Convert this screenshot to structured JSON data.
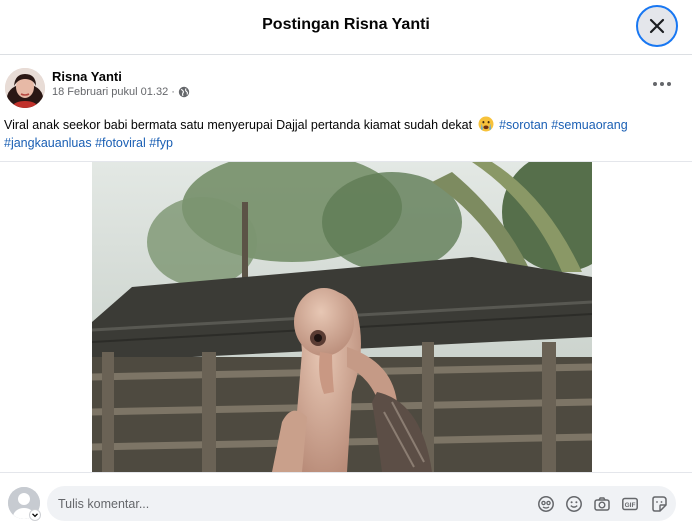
{
  "header": {
    "title": "Postingan Risna Yanti",
    "close_icon": "close-icon"
  },
  "post": {
    "author": "Risna Yanti",
    "timestamp": "18 Februari pukul 01.32",
    "separator": "·",
    "privacy_icon": "globe-icon",
    "more_icon": "more-horizontal-icon",
    "caption_text": "Viral anak seekor babi bermata satu menyerupai Dajjal pertanda kiamat sudah dekat",
    "caption_emoji": "crying-face-emoji",
    "hashtags": [
      "#sorotan",
      "#semuaorang",
      "#jangkauanluas",
      "#fotoviral",
      "#fyp"
    ]
  },
  "comment_bar": {
    "placeholder": "Tulis komentar...",
    "tools": [
      "avatar-sticker-icon",
      "emoji-icon",
      "camera-icon",
      "gif-icon",
      "sticker-icon"
    ]
  },
  "colors": {
    "link": "#1a5fb4",
    "accent_ring": "#1877f2",
    "secondary_text": "#65676b"
  }
}
